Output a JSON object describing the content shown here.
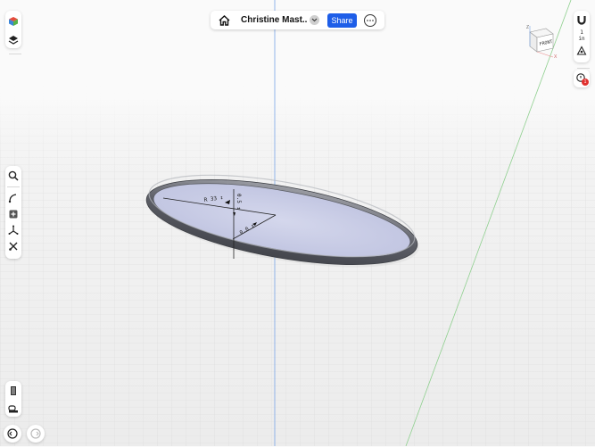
{
  "app": {
    "document_title": "Christine Mast...",
    "share_label": "Share"
  },
  "icons": {
    "home": "home-icon",
    "title_dropdown": "chevron-down-icon",
    "more": "more-options-icon",
    "appearance": "appearance-cube-icon",
    "layers": "layers-icon",
    "search": "search-icon",
    "sketch": "sketch-icon",
    "add": "add-primitive-icon",
    "move": "move-icon",
    "tools": "tools-icon",
    "magnet": "magnet-icon",
    "units": "units-icon",
    "snap": "snap-icon",
    "info": "info-icon",
    "history": "history-icon",
    "measure": "measure-icon",
    "undo": "undo-icon",
    "redo": "redo-icon"
  },
  "view_cube": {
    "face_label": "FRONT",
    "axis_z": "Z",
    "axis_x": "X",
    "axis_y": "Y"
  },
  "units": {
    "value": "1",
    "unit": "in"
  },
  "notification_count": "1",
  "dimensions": {
    "radius_label": "R 33 ↕",
    "height_label": "0.5 ↕",
    "offset_label": "0.0 ↕"
  },
  "colors": {
    "accent": "#1e5ee8",
    "badge": "#e0302e",
    "ring": "#6e7078",
    "disk_fill": "#c9cde6"
  }
}
